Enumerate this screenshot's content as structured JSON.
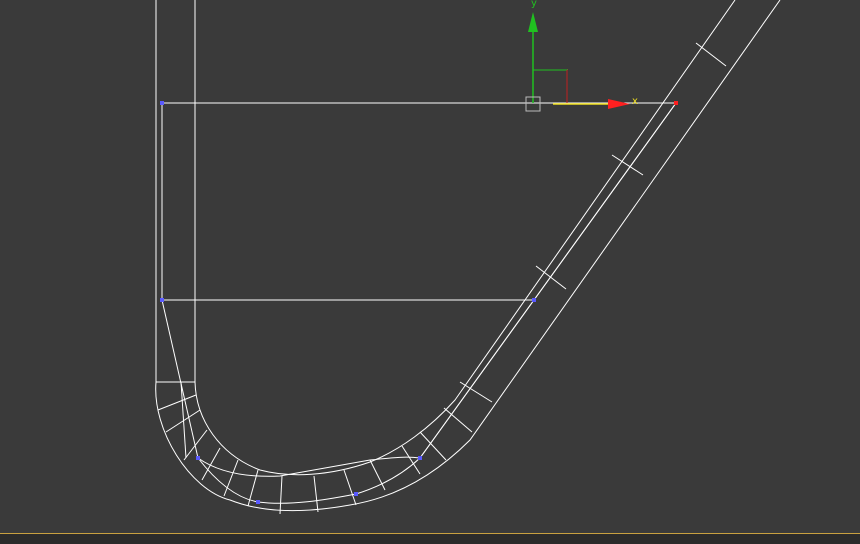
{
  "viewport": {
    "background": "#3a3a3a",
    "wire_color": "#ffffff",
    "vertex_color": "#5a5aff"
  },
  "gizmo": {
    "x_label": "x",
    "y_label": "y",
    "x_color": "#ff2020",
    "x_axis_highlight": "#f0e020",
    "y_color": "#20c020",
    "plane_color": "#ffff00",
    "center_icon": "move-gizmo-center-icon"
  },
  "timebar": {
    "accent": "#c8a040"
  }
}
